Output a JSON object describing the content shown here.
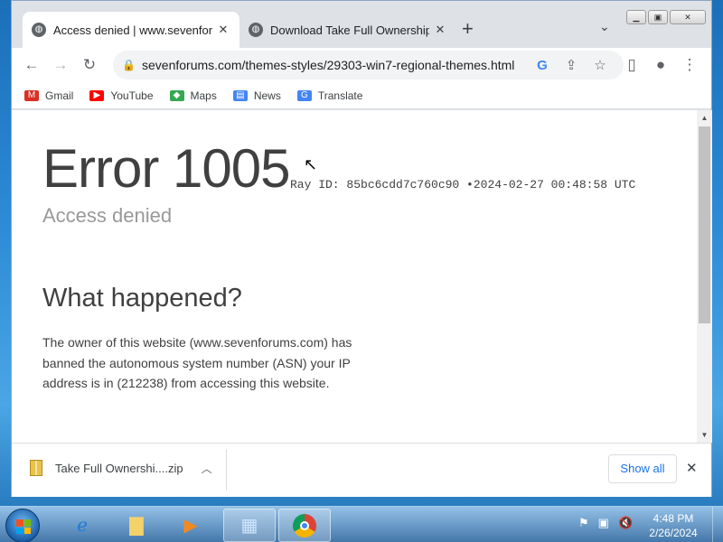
{
  "browser": {
    "tabs": [
      {
        "title": "Access denied | www.sevenforums",
        "active": true
      },
      {
        "title": "Download Take Full Ownership o",
        "active": false
      }
    ],
    "url": "sevenforums.com/themes-styles/29303-win7-regional-themes.html"
  },
  "bookmarks": [
    {
      "label": "Gmail",
      "icon": "gmail-icon",
      "color": "#d93025"
    },
    {
      "label": "YouTube",
      "icon": "youtube-icon",
      "color": "#ff0000"
    },
    {
      "label": "Maps",
      "icon": "maps-icon",
      "color": "#34a853"
    },
    {
      "label": "News",
      "icon": "news-icon",
      "color": "#4285f4"
    },
    {
      "label": "Translate",
      "icon": "translate-icon",
      "color": "#4285f4"
    }
  ],
  "page": {
    "error_title": "Error 1005",
    "ray_id": "Ray ID: 85bc6cdd7c760c90",
    "bullet": "•",
    "timestamp": "2024-02-27 00:48:58 UTC",
    "subtitle": "Access denied",
    "heading": "What happened?",
    "explanation": "The owner of this website (www.sevenforums.com) has banned the autonomous system number (ASN) your IP address is in (212238) from accessing this website."
  },
  "downloads": {
    "filename": "Take Full Ownershi....zip",
    "show_all": "Show all"
  },
  "taskbar": {
    "time": "4:48 PM",
    "date": "2/26/2024"
  }
}
